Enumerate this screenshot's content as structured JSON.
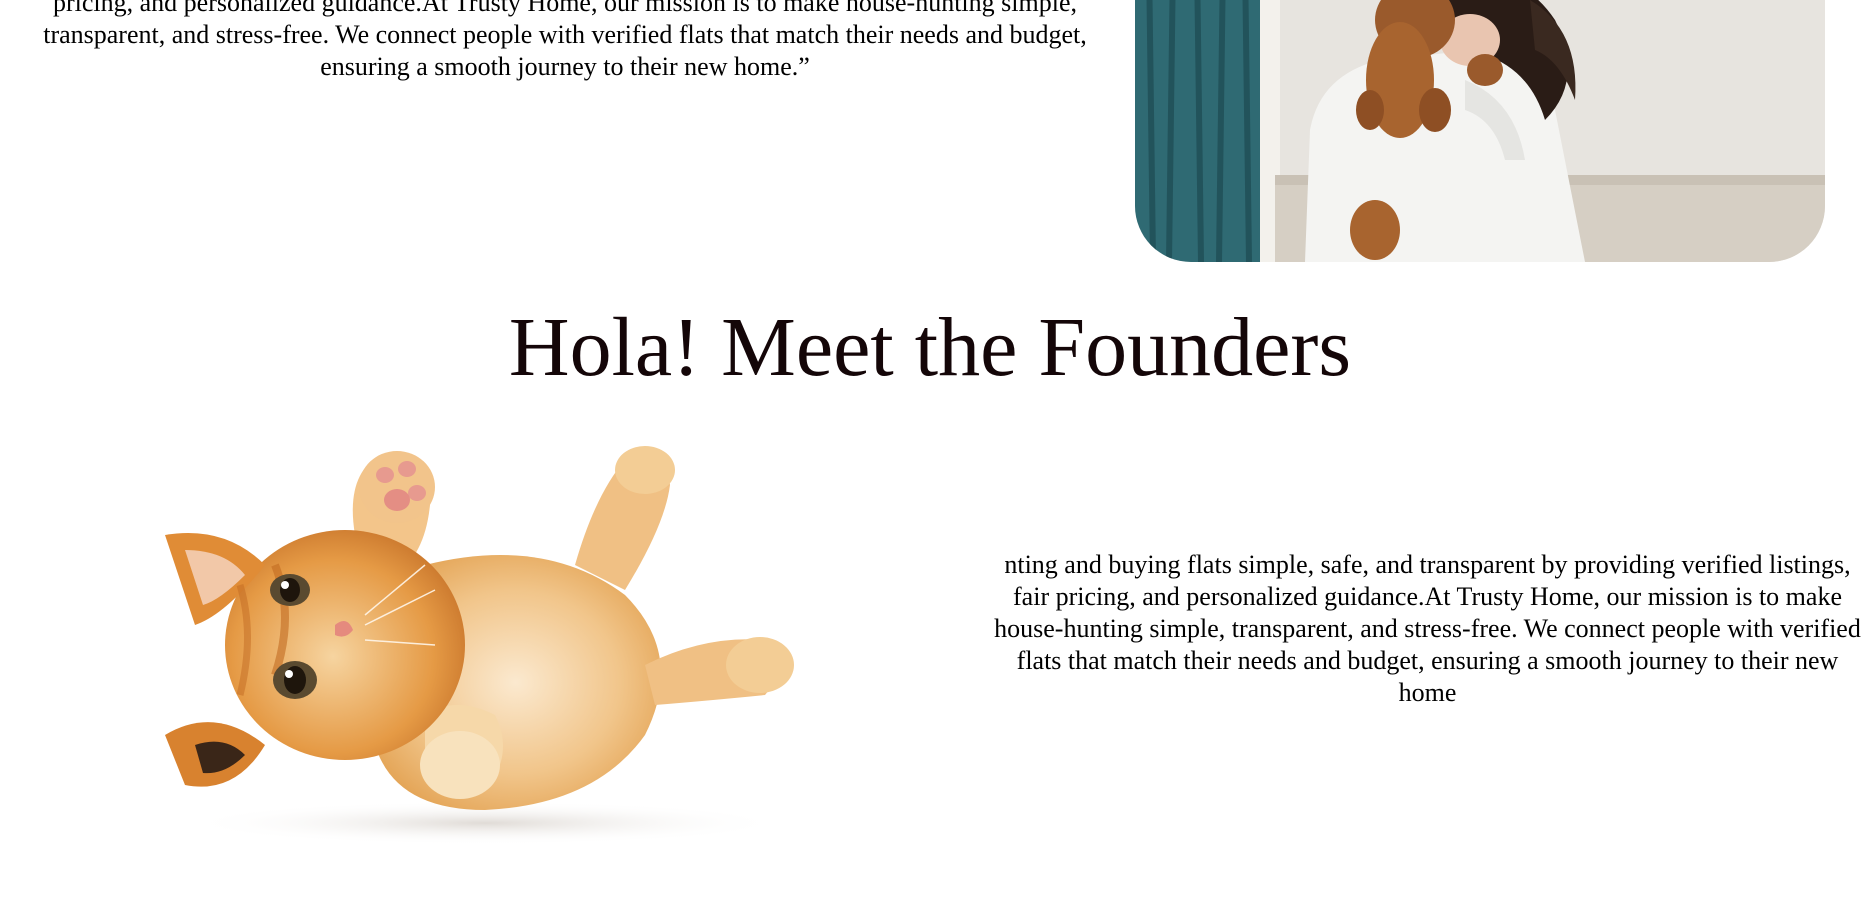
{
  "mission": {
    "text": "pricing, and personalized guidance.At Trusty Home, our mission is to make house-hunting simple, transparent, and stress-free. We connect people with verified flats that match their needs and budget, ensuring a smooth journey to their new home.”"
  },
  "about_image": {
    "subject": "woman-hugging-dog-photo"
  },
  "founders": {
    "heading": "Hola! Meet the Founders",
    "image_subject": "kitten-photo",
    "text": "nting and buying flats simple, safe, and transparent by providing verified listings, fair pricing, and personalized guidance.At Trusty Home, our mission is to make house-hunting simple, transparent, and stress-free. We connect people with verified flats that match their needs and budget, ensuring a smooth journey to their new home"
  },
  "colors": {
    "background": "#ffffff",
    "text": "#000000",
    "heading": "#140608"
  }
}
